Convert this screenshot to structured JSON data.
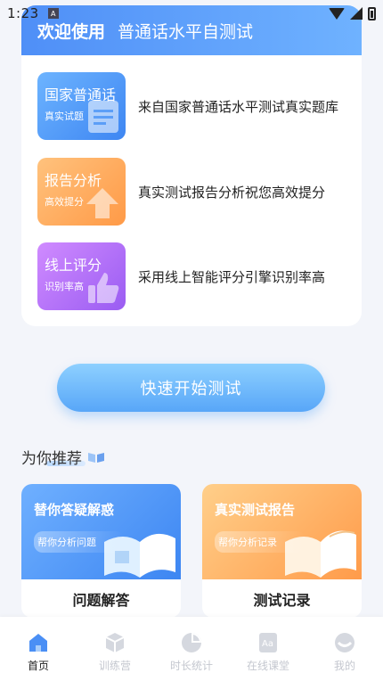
{
  "status_bar": {
    "time": "1:23",
    "app_badge": "A"
  },
  "welcome": {
    "title": "欢迎使用",
    "subtitle": "普通话水平自测试",
    "features": [
      {
        "tile_title": "国家普通话",
        "tile_sub": "真实试题",
        "text": "来自国家普通话水平测试真实题库"
      },
      {
        "tile_title": "报告分析",
        "tile_sub": "高效提分",
        "text": "真实测试报告分析祝您高效提分"
      },
      {
        "tile_title": "线上评分",
        "tile_sub": "识别率高",
        "text": "采用线上智能评分引擎识别率高"
      }
    ]
  },
  "start_button": {
    "label": "快速开始测试"
  },
  "recommend": {
    "title": "为你推荐",
    "cards": [
      {
        "headline": "替你答疑解惑",
        "pill": "帮你分析问题",
        "label": "问题解答"
      },
      {
        "headline": "真实测试报告",
        "pill": "帮你分析记录",
        "label": "测试记录"
      }
    ]
  },
  "tabs": [
    {
      "label": "首页",
      "active": true
    },
    {
      "label": "训练营",
      "active": false
    },
    {
      "label": "时长统计",
      "active": false
    },
    {
      "label": "在线课堂",
      "active": false
    },
    {
      "label": "我的",
      "active": false
    }
  ],
  "colors": {
    "primary": "#4f8ff7",
    "tab_active": "#4a8ff5",
    "tab_inactive": "#c4c7cf"
  }
}
